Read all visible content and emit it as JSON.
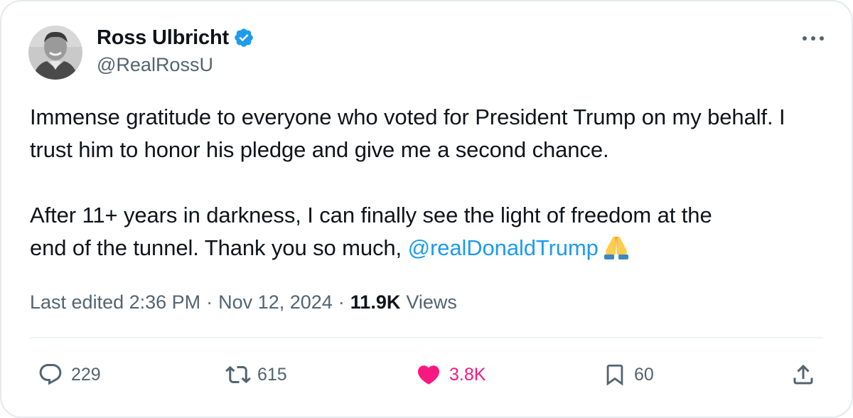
{
  "tweet": {
    "author": {
      "display_name": "Ross Ulbricht",
      "handle": "@RealRossU",
      "verified": true,
      "avatar_icon": "avatar-photo"
    },
    "text": {
      "paragraph1": "Immense gratitude to everyone who voted for President Trump on my behalf. I trust him to honor his pledge and give me a second chance.",
      "paragraph2_line1": "After 11+ years in darkness, I can finally see the light of freedom at the",
      "paragraph2_line2_prefix": "end of the tunnel. Thank you so much, ",
      "mention": "@realDonaldTrump",
      "emoji": "🙏"
    },
    "meta": {
      "edited_label": "Last edited 2:36 PM",
      "separator": "·",
      "date": "Nov 12, 2024",
      "views_count": "11.9K",
      "views_label": "Views"
    },
    "actions": {
      "reply_count": "229",
      "retweet_count": "615",
      "like_count": "3.8K",
      "bookmark_count": "60"
    },
    "colors": {
      "accent": "#1d9bf0",
      "like": "#f91880",
      "secondary_text": "#536471",
      "primary_text": "#0f1419"
    }
  }
}
